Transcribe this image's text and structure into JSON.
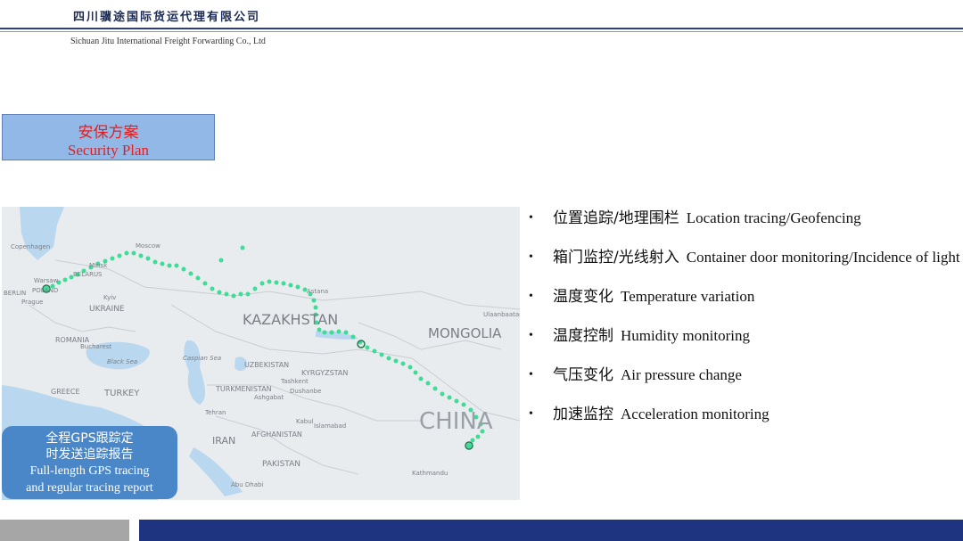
{
  "header": {
    "company_cn": "四川骥途国际货运代理有限公司",
    "company_en": "Sichuan Jitu International Freight Forwarding Co., Ltd"
  },
  "section": {
    "title_cn": "安保方案",
    "title_en": "Security Plan"
  },
  "map": {
    "labels": {
      "kazakhstan": "KAZAKHSTAN",
      "mongolia": "MONGOLIA",
      "china": "CHINA",
      "ukraine": "UKRAINE",
      "turkey": "TURKEY",
      "iran": "IRAN",
      "afghanistan": "AFGHANISTAN",
      "pakistan": "PAKISTAN",
      "uzbekistan": "UZBEKISTAN",
      "turkmenistan": "TURKMENISTAN",
      "kyrgyzstan": "KYRGYZSTAN",
      "romania": "ROMANIA",
      "greece": "GREECE",
      "poland": "POLAND",
      "moscow": "Moscow",
      "warsaw": "Warsaw",
      "berlin": "BERLIN",
      "kyiv": "Kyiv",
      "black_sea": "Black Sea",
      "caspian_sea": "Caspian Sea",
      "tehran": "Tehran",
      "kabul": "Kabul",
      "islamabad": "Islamabad",
      "astana": "Astana",
      "ulaanbaatar": "Ulaanbaatar",
      "copenhagen": "Copenhagen",
      "prague": "Prague",
      "bucharest": "Bucharest",
      "dushanbe": "Dushanbe",
      "tashkent": "Tashkent",
      "ashgabat": "Ashgabat",
      "kathmandu": "Kathmandu",
      "abu_dhabi": "Abu Dhabi",
      "minsk": "Minsk",
      "belarus": "BELARUS"
    },
    "route_color": "#3ddc97"
  },
  "callout": {
    "line1_cn": "全程GPS跟踪定",
    "line2_cn": "时发送追踪报告",
    "line1_en": "Full-length GPS tracing",
    "line2_en": "and regular tracing report"
  },
  "features": [
    {
      "cn": "位置追踪/地理围栏",
      "en": "Location tracing/Geofencing"
    },
    {
      "cn": "箱门监控/光线射入",
      "en": "Container door monitoring/Incidence of light"
    },
    {
      "cn": "温度变化",
      "en": "Temperature variation"
    },
    {
      "cn": "温度控制",
      "en": "Humidity monitoring"
    },
    {
      "cn": "气压变化",
      "en": "Air pressure change"
    },
    {
      "cn": "加速监控",
      "en": "Acceleration monitoring"
    }
  ],
  "colors": {
    "brand_blue": "#1f3480",
    "section_bg": "#92b8e8",
    "section_text": "#e02020",
    "callout_bg": "#4a87c8"
  }
}
